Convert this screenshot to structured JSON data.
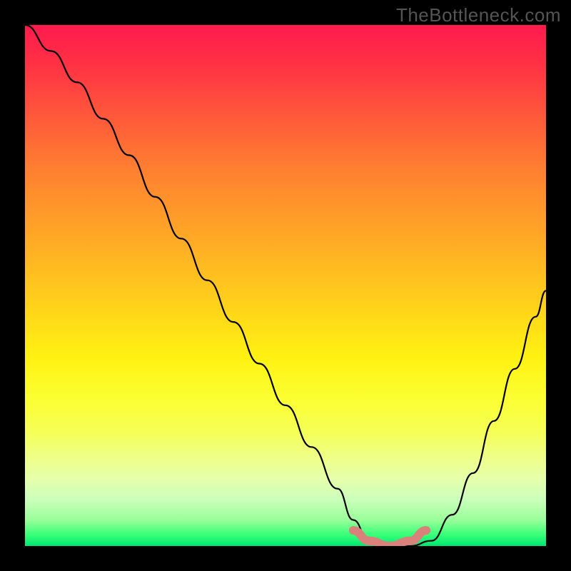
{
  "watermark": "TheBottleneck.com",
  "chart_data": {
    "type": "line",
    "title": "",
    "xlabel": "",
    "ylabel": "",
    "xlim": [
      0,
      100
    ],
    "ylim": [
      0,
      100
    ],
    "grid": false,
    "legend": false,
    "gradient_stops": [
      {
        "pos": 0,
        "color": "#ff1a4d"
      },
      {
        "pos": 18,
        "color": "#ff5a3a"
      },
      {
        "pos": 40,
        "color": "#ffa626"
      },
      {
        "pos": 64,
        "color": "#fff212"
      },
      {
        "pos": 83,
        "color": "#e6ffaa"
      },
      {
        "pos": 100,
        "color": "#00e673"
      }
    ],
    "series": [
      {
        "name": "bottleneck-curve",
        "color": "#000000",
        "x": [
          0,
          5,
          10,
          15,
          20,
          25,
          30,
          35,
          40,
          45,
          50,
          55,
          60,
          63,
          66,
          70,
          74,
          78,
          82,
          86,
          90,
          94,
          98,
          100
        ],
        "y": [
          100,
          95,
          89,
          82,
          75,
          67,
          59,
          51,
          43,
          35,
          27,
          19,
          11,
          5,
          1,
          0,
          0,
          1,
          6,
          14,
          24,
          34,
          44,
          49
        ]
      },
      {
        "name": "optimal-range-marker",
        "color": "#d9817a",
        "x": [
          63,
          66,
          70,
          74,
          77
        ],
        "y": [
          3,
          1,
          0,
          1,
          3
        ]
      }
    ],
    "annotations": []
  }
}
